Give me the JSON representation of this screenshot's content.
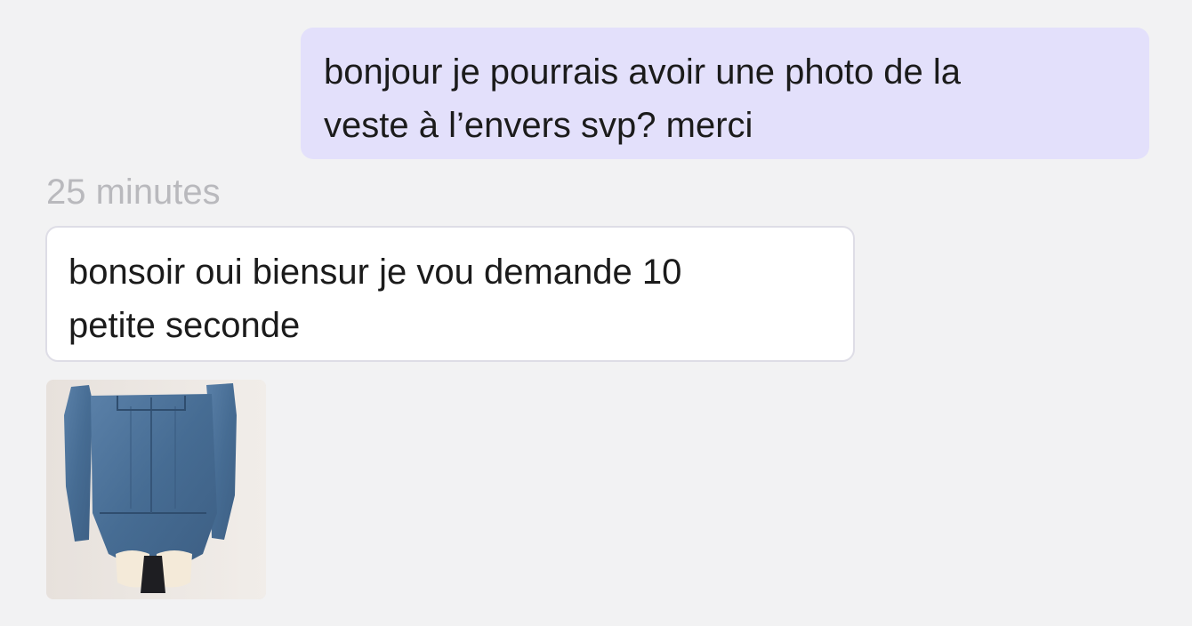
{
  "messages": {
    "outgoing_1": {
      "line_1": "bonjour je pourrais avoir une photo de la",
      "line_2": "veste à l’envers svp? merci"
    },
    "timestamp": "25 minutes",
    "incoming_1": {
      "line_1": "bonsoir oui biensur je vou demande 10",
      "line_2": "petite seconde"
    },
    "incoming_photo": {
      "subject": "denim-jacket-photo"
    }
  },
  "colors": {
    "background": "#f2f2f3",
    "outgoing_bubble": "#e3e0fb",
    "incoming_bubble": "#ffffff",
    "timestamp_text": "#b9b9bd",
    "denim": "#4a6f96"
  }
}
